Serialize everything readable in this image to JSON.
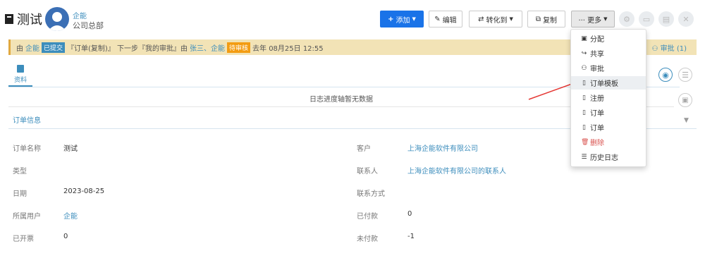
{
  "header": {
    "title": "测试",
    "owner_name": "企能",
    "owner_dept": "公司总部"
  },
  "toolbar": {
    "add_label": "添加",
    "edit_label": "编辑",
    "convert_label": "转化到",
    "copy_label": "复制",
    "more_label": "··· 更多"
  },
  "status_bar": {
    "prefix": "由",
    "user": "企能",
    "badge_submitted": "已提交",
    "flow_text": "『订单(复制)』 下一步『我的审批』由",
    "approvers": "张三、企能",
    "badge_pending": "待审核",
    "time_text": "去年 08月25日 12:55",
    "approve_link": "审批 (1)"
  },
  "tabs": {
    "info_label": "资料"
  },
  "timeline": {
    "empty_text": "日志进度轴暂无数据"
  },
  "section": {
    "title": "订单信息"
  },
  "fields": {
    "order_name_label": "订单名称",
    "order_name_value": "测试",
    "customer_label": "客户",
    "customer_value": "上海企能软件有限公司",
    "type_label": "类型",
    "type_value": "",
    "contact_label": "联系人",
    "contact_value": "上海企能软件有限公司的联系人",
    "date_label": "日期",
    "date_value": "2023-08-25",
    "contact_method_label": "联系方式",
    "contact_method_value": "",
    "owner_label": "所属用户",
    "owner_value": "企能",
    "paid_label": "已付款",
    "paid_value": "0",
    "invoiced_label": "已开票",
    "invoiced_value": "0",
    "unpaid_label": "未付款",
    "unpaid_value": "-1"
  },
  "more_menu": [
    {
      "label": "分配",
      "icon": "assign-icon"
    },
    {
      "label": "共享",
      "icon": "share-icon"
    },
    {
      "label": "审批",
      "icon": "sitemap-icon"
    },
    {
      "label": "订单模板",
      "icon": "file-icon"
    },
    {
      "label": "注册",
      "icon": "file-icon"
    },
    {
      "label": "订单",
      "icon": "file-icon"
    },
    {
      "label": "订单",
      "icon": "file-icon"
    },
    {
      "label": "删除",
      "icon": "trash-icon"
    },
    {
      "label": "历史日志",
      "icon": "list-icon"
    }
  ],
  "colors": {
    "accent": "#3c8dbc",
    "primary": "#1a73e8",
    "warning": "#f39c12",
    "danger": "#d9534f"
  }
}
